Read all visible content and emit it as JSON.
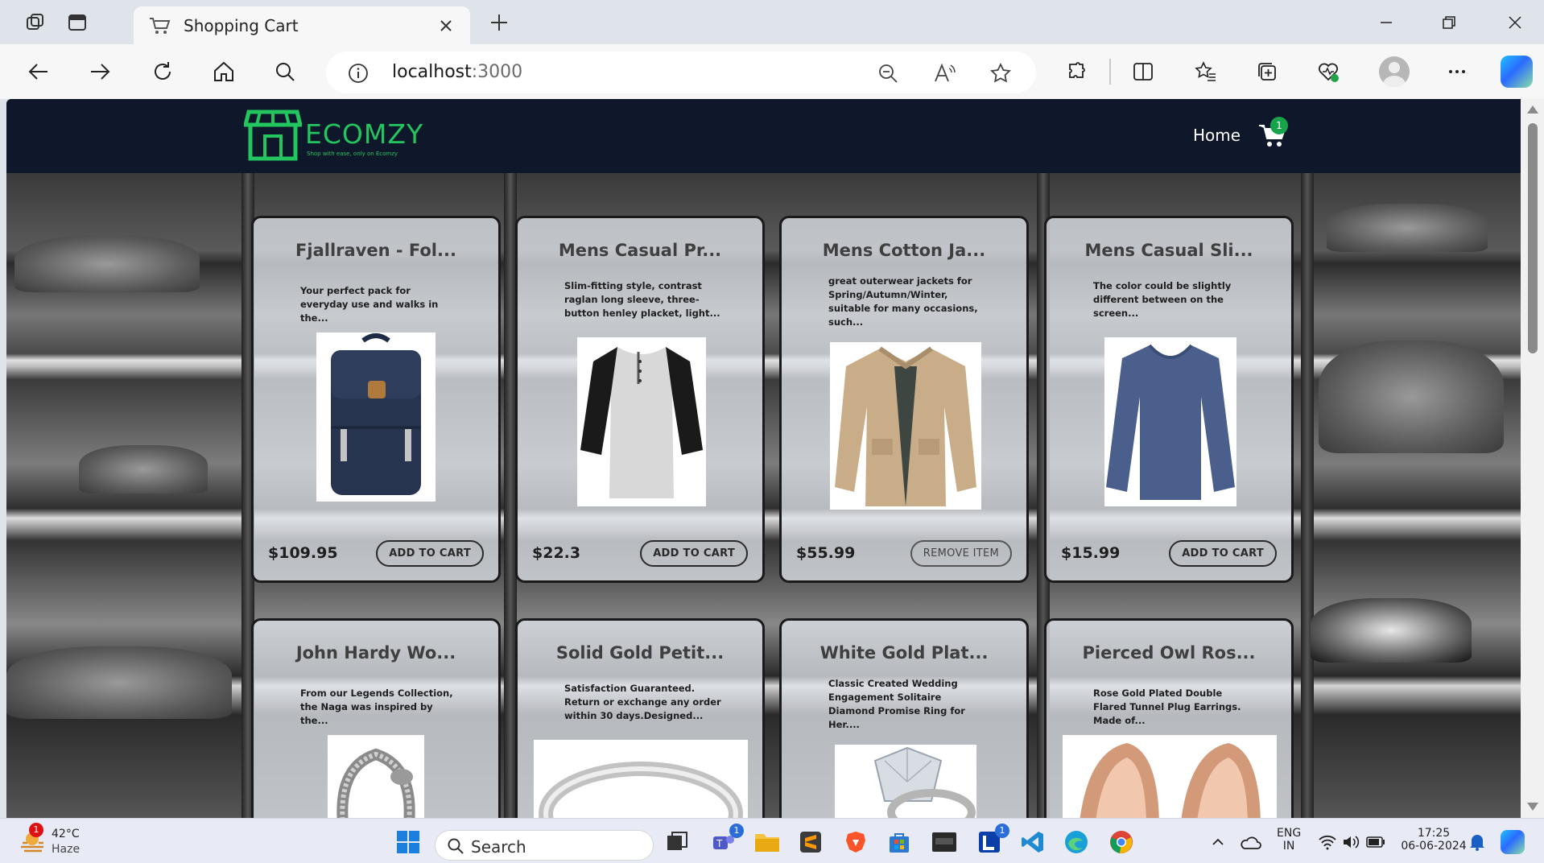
{
  "browser": {
    "tab_title": "Shopping Cart",
    "url_host": "localhost",
    "url_port": ":3000"
  },
  "site": {
    "logo_text": "ECOMZY",
    "logo_tagline": "Shop with ease, only on Ecomzy",
    "nav_home": "Home",
    "cart_count": "1",
    "brand_color": "#22c55e",
    "navbar_color": "#0f172a"
  },
  "products": [
    {
      "title": "Fjallraven - Fol...",
      "description": "Your perfect pack for everyday use and walks in the...",
      "price": "$109.95",
      "button": "ADD TO CART",
      "image": "backpack"
    },
    {
      "title": "Mens Casual Pr...",
      "description": "Slim-fitting style, contrast raglan long sleeve, three-button henley placket, light...",
      "price": "$22.3",
      "button": "ADD TO CART",
      "image": "raglan-tshirt"
    },
    {
      "title": "Mens Cotton Ja...",
      "description": "great outerwear jackets for Spring/Autumn/Winter, suitable for many occasions, such...",
      "price": "$55.99",
      "button": "REMOVE ITEM",
      "image": "cotton-jacket"
    },
    {
      "title": "Mens Casual Sli...",
      "description": "The color could be slightly different between on the screen...",
      "price": "$15.99",
      "button": "ADD TO CART",
      "image": "blue-long-sleeve"
    },
    {
      "title": "John Hardy Wo...",
      "description": "From our Legends Collection, the Naga was inspired by the...",
      "image": "dragon-bracelet"
    },
    {
      "title": "Solid Gold Petit...",
      "description": "Satisfaction Guaranteed. Return or exchange any order within 30 days.Designed...",
      "image": "gold-ring"
    },
    {
      "title": "White Gold Plat...",
      "description": "Classic Created Wedding Engagement Solitaire Diamond Promise Ring for Her....",
      "image": "diamond-ring"
    },
    {
      "title": "Pierced Owl Ros...",
      "description": "Rose Gold Plated Double Flared Tunnel Plug Earrings. Made of...",
      "image": "rose-gold-plugs"
    }
  ],
  "taskbar": {
    "weather_temp": "42°C",
    "weather_cond": "Haze",
    "weather_badge": "1",
    "search_label": "Search",
    "teams_badge": "1",
    "lens_badge": "1",
    "lang_line1": "ENG",
    "lang_line2": "IN",
    "time": "17:25",
    "date": "06-06-2024"
  }
}
